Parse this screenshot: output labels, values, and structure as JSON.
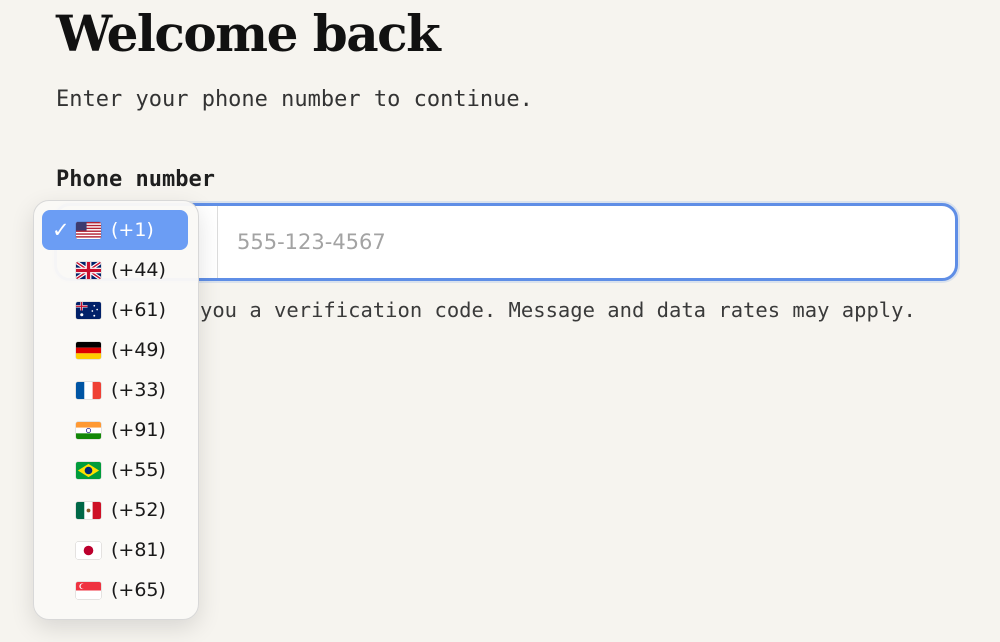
{
  "header": {
    "title": "Welcome back",
    "subtitle": "Enter your phone number to continue."
  },
  "form": {
    "phone_label": "Phone number",
    "phone_placeholder": "555-123-4567",
    "phone_value": "",
    "helper_text_visible": "you a verification code. Message and data rates may apply.",
    "selected_country_code": "(+1)"
  },
  "dropdown": {
    "options": [
      {
        "code": "(+1)",
        "flag": "us-flag-icon",
        "selected": true
      },
      {
        "code": "(+44)",
        "flag": "gb-flag-icon",
        "selected": false
      },
      {
        "code": "(+61)",
        "flag": "au-flag-icon",
        "selected": false
      },
      {
        "code": "(+49)",
        "flag": "de-flag-icon",
        "selected": false
      },
      {
        "code": "(+33)",
        "flag": "fr-flag-icon",
        "selected": false
      },
      {
        "code": "(+91)",
        "flag": "in-flag-icon",
        "selected": false
      },
      {
        "code": "(+55)",
        "flag": "br-flag-icon",
        "selected": false
      },
      {
        "code": "(+52)",
        "flag": "mx-flag-icon",
        "selected": false
      },
      {
        "code": "(+81)",
        "flag": "jp-flag-icon",
        "selected": false
      },
      {
        "code": "(+65)",
        "flag": "sg-flag-icon",
        "selected": false
      }
    ]
  },
  "colors": {
    "background": "#f6f4ef",
    "focus_border": "#5f8ee6",
    "selected_option": "#6b9df4"
  }
}
